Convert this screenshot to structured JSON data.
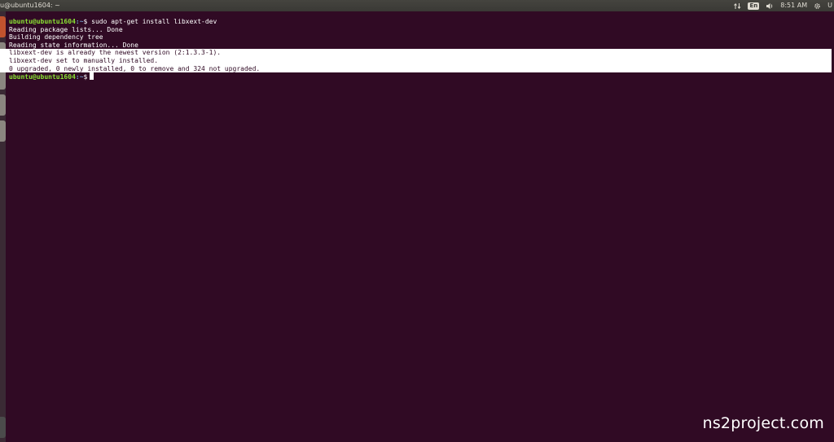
{
  "window": {
    "title": "u@ubuntu1604: ~"
  },
  "panel": {
    "language": "En",
    "volume_icon": "speaker-icon",
    "network_icon": "network-arrows-icon",
    "time": "8:51 AM",
    "session_icon": "gear-icon",
    "user": "U"
  },
  "terminal": {
    "line1_user": "ubuntu@ubuntu1604",
    "line1_path": ":~",
    "line1_cmd": "$ sudo apt-get install libxext-dev",
    "line2": "Reading package lists... Done",
    "line3": "Building dependency tree",
    "line4": "Reading state information... Done",
    "line5": "libxext-dev is already the newest version (2:1.3.3-1).",
    "line6": "libxext-dev set to manually installed.",
    "line7": "0 upgraded, 0 newly installed, 0 to remove and 324 not upgraded.",
    "line8_user": "ubuntu@ubuntu1604",
    "line8_path": ":~",
    "line8_prompt": "$"
  },
  "watermark": {
    "text": "ns2project.com"
  },
  "colors": {
    "terminal_bg": "#300a24",
    "prompt_user": "#8ae234",
    "prompt_path": "#729fcf",
    "panel_bg": "#3a3935"
  }
}
